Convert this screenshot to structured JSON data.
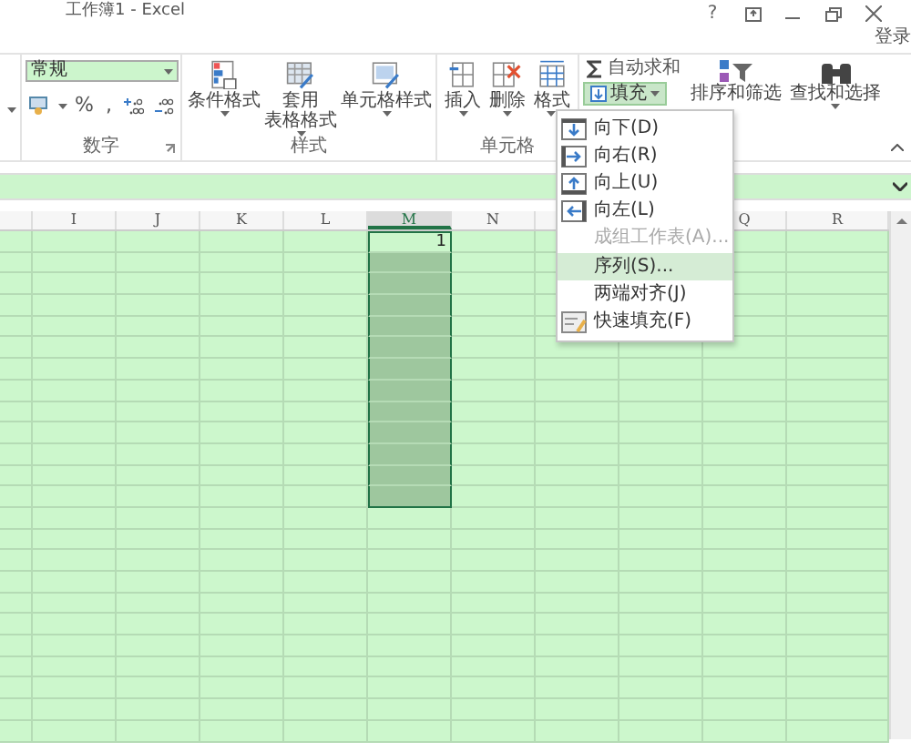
{
  "window": {
    "title": "工作簿1 - Excel",
    "help": "?",
    "sign_in": "登录"
  },
  "ribbon": {
    "number_group": {
      "label": "数字",
      "format": "常规",
      "percent": "%",
      "comma": ","
    },
    "styles_group": {
      "label": "样式",
      "buttons": [
        {
          "lines": [
            "条件格式"
          ]
        },
        {
          "lines": [
            "套用",
            "表格格式"
          ]
        },
        {
          "lines": [
            "单元格样式"
          ]
        }
      ]
    },
    "cells_group": {
      "label": "单元格",
      "buttons": [
        {
          "lines": [
            "插入"
          ]
        },
        {
          "lines": [
            "删除"
          ]
        },
        {
          "lines": [
            "格式"
          ]
        }
      ]
    },
    "editing_group": {
      "autosum": "自动求和",
      "fill": {
        "label": "填充",
        "expanded": true
      },
      "sort": "排序和筛选",
      "find": "查找和选择"
    }
  },
  "grid": {
    "columns": [
      {
        "label": "I",
        "selected": false
      },
      {
        "label": "J",
        "selected": false
      },
      {
        "label": "K",
        "selected": false
      },
      {
        "label": "L",
        "selected": false
      },
      {
        "label": "M",
        "selected": true
      },
      {
        "label": "N",
        "selected": false
      },
      {
        "selected": false
      },
      {
        "selected": false
      },
      {
        "label": "Q",
        "selected": false
      },
      {
        "label": "R",
        "selected": false
      }
    ],
    "rows": [
      {
        "selected": true,
        "value": "1"
      },
      {
        "selected": true
      },
      {
        "selected": true
      },
      {
        "selected": true
      },
      {
        "selected": true
      },
      {
        "selected": true
      },
      {
        "selected": true
      },
      {
        "selected": true
      },
      {
        "selected": true
      },
      {
        "selected": true
      },
      {
        "selected": true
      },
      {
        "selected": true
      },
      {
        "selected": true
      },
      {
        "selected": false
      },
      {
        "selected": false
      },
      {
        "selected": false
      },
      {
        "selected": false
      },
      {
        "selected": false
      },
      {
        "selected": false
      },
      {
        "selected": false
      },
      {
        "selected": false
      },
      {
        "selected": false
      },
      {
        "selected": false
      },
      {
        "selected": false
      }
    ]
  },
  "fill_menu": [
    {
      "label": "向下(D)",
      "disabled": false,
      "selected": false
    },
    {
      "label": "向右(R)",
      "disabled": false,
      "selected": false
    },
    {
      "label": "向上(U)",
      "disabled": false,
      "selected": false
    },
    {
      "label": "向左(L)",
      "disabled": false,
      "selected": false
    },
    {
      "label": "成组工作表(A)...",
      "disabled": true,
      "selected": false
    },
    {
      "label": "序列(S)...",
      "disabled": false,
      "selected": true
    },
    {
      "label": "两端对齐(J)",
      "disabled": false,
      "selected": false
    },
    {
      "label": "快速填充(F)",
      "disabled": false,
      "selected": false
    }
  ]
}
